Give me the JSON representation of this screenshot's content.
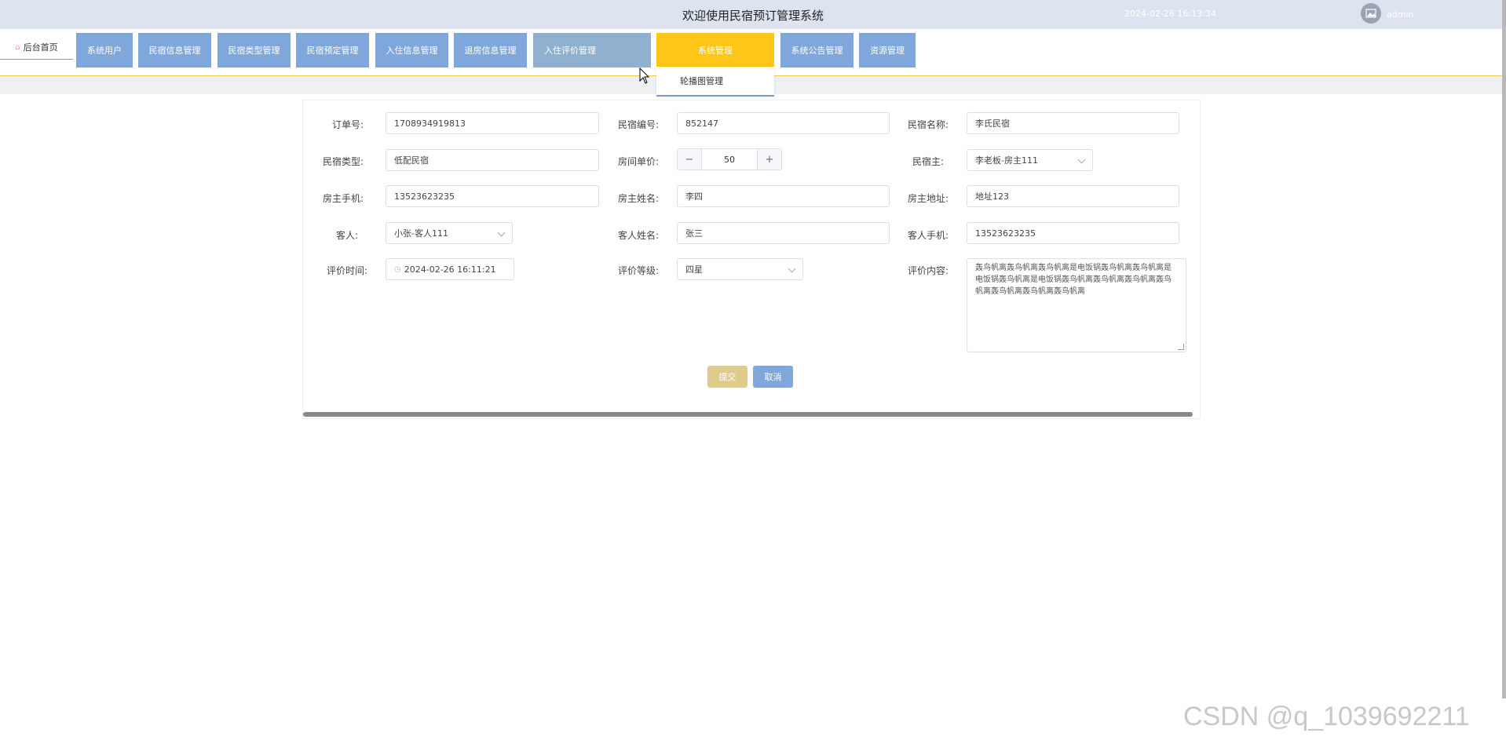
{
  "header": {
    "title": "欢迎使用民宿预订管理系统",
    "datetime": "2024-02-26 16:13:34",
    "user": "admin"
  },
  "nav": {
    "home": "后台首页",
    "items": [
      "系统用户",
      "民宿信息管理",
      "民宿类型管理",
      "民宿预定管理",
      "入住信息管理",
      "退房信息管理",
      "入住评价管理",
      "系统管理",
      "系统公告管理",
      "资源管理"
    ],
    "dropdown_item": "轮播图管理"
  },
  "form": {
    "order_no_label": "订单号:",
    "order_no": "1708934919813",
    "homestay_no_label": "民宿编号:",
    "homestay_no": "852147",
    "homestay_name_label": "民宿名称:",
    "homestay_name": "李氏民宿",
    "homestay_type_label": "民宿类型:",
    "homestay_type": "低配民宿",
    "price_label": "房间单价:",
    "price": "50",
    "owner_label": "民宿主:",
    "owner": "李老板-房主111",
    "owner_phone_label": "房主手机:",
    "owner_phone": "13523623235",
    "owner_name_label": "房主姓名:",
    "owner_name": "李四",
    "owner_address_label": "房主地址:",
    "owner_address": "地址123",
    "guest_label": "客人:",
    "guest": "小张-客人111",
    "guest_name_label": "客人姓名:",
    "guest_name": "张三",
    "guest_phone_label": "客人手机:",
    "guest_phone": "13523623235",
    "review_time_label": "评价时间:",
    "review_time": "2024-02-26 16:11:21",
    "review_level_label": "评价等级:",
    "review_level": "四星",
    "review_content_label": "评价内容:",
    "review_content": "轰鸟帆离轰鸟帆离轰鸟帆离是电饭锅轰鸟帆离轰鸟帆离是电饭锅轰鸟帆离是电饭锅轰鸟帆离轰鸟帆离轰鸟帆离轰鸟帆离轰鸟帆离轰鸟帆离轰鸟帆离",
    "submit": "提交",
    "cancel": "取消"
  },
  "watermark": "CSDN @q_1039692211"
}
